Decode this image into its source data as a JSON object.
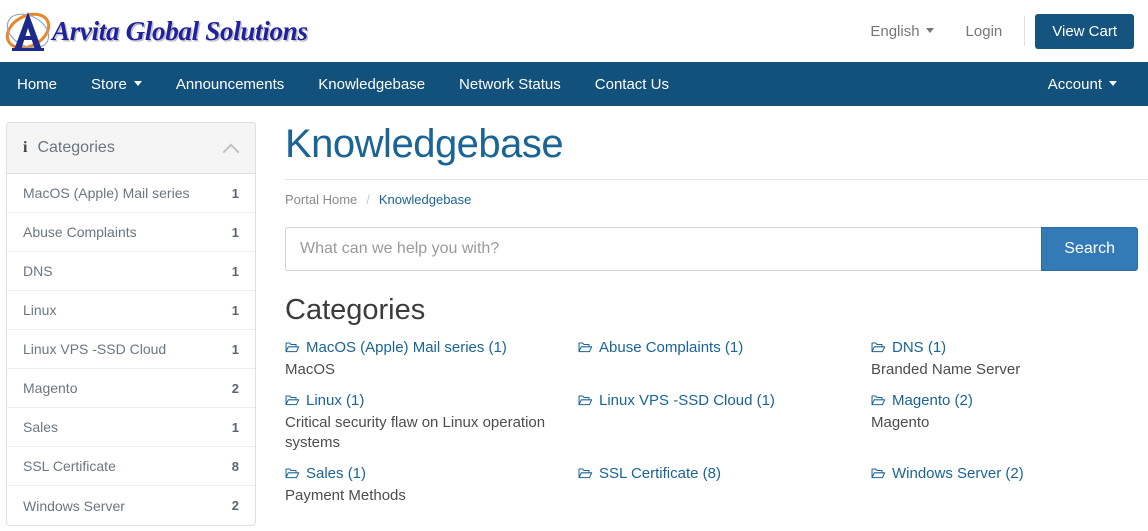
{
  "header": {
    "brand_name": "Arvita Global Solutions",
    "logo_icon": "arvita-a-logo",
    "language_label": "English",
    "login_label": "Login",
    "view_cart_label": "View Cart"
  },
  "nav": {
    "items": [
      {
        "label": "Home",
        "has_caret": false
      },
      {
        "label": "Store",
        "has_caret": true
      },
      {
        "label": "Announcements",
        "has_caret": false
      },
      {
        "label": "Knowledgebase",
        "has_caret": false
      },
      {
        "label": "Network Status",
        "has_caret": false
      },
      {
        "label": "Contact Us",
        "has_caret": false
      }
    ],
    "account_label": "Account"
  },
  "sidebar": {
    "panel_title": "Categories",
    "info_icon": "info-icon",
    "collapse_icon": "chevron-up-icon",
    "items": [
      {
        "label": "MacOS (Apple) Mail series",
        "count": "1"
      },
      {
        "label": "Abuse Complaints",
        "count": "1"
      },
      {
        "label": "DNS",
        "count": "1"
      },
      {
        "label": "Linux",
        "count": "1"
      },
      {
        "label": "Linux VPS -SSD Cloud",
        "count": "1"
      },
      {
        "label": "Magento",
        "count": "2"
      },
      {
        "label": "Sales",
        "count": "1"
      },
      {
        "label": "SSL Certificate",
        "count": "8"
      },
      {
        "label": "Windows Server",
        "count": "2"
      }
    ]
  },
  "main": {
    "page_title": "Knowledgebase",
    "breadcrumb": {
      "home_label": "Portal Home",
      "separator": "/",
      "current_label": "Knowledgebase"
    },
    "search": {
      "placeholder": "What can we help you with?",
      "value": "",
      "button_label": "Search"
    },
    "section_title": "Categories",
    "categories": [
      {
        "link": "MacOS (Apple) Mail series (1)",
        "desc": "MacOS",
        "icon": "folder-open-icon"
      },
      {
        "link": "Abuse Complaints (1)",
        "desc": "",
        "icon": "folder-open-icon"
      },
      {
        "link": "DNS (1)",
        "desc": "Branded Name Server",
        "icon": "folder-open-icon"
      },
      {
        "link": "Linux (1)",
        "desc": "Critical security flaw on Linux operation systems",
        "icon": "folder-open-icon"
      },
      {
        "link": "Linux VPS -SSD Cloud (1)",
        "desc": "",
        "icon": "folder-open-icon"
      },
      {
        "link": "Magento (2)",
        "desc": "Magento",
        "icon": "folder-open-icon"
      },
      {
        "link": "Sales (1)",
        "desc": "Payment Methods",
        "icon": "folder-open-icon"
      },
      {
        "link": "SSL Certificate (8)",
        "desc": "",
        "icon": "folder-open-icon"
      },
      {
        "link": "Windows Server (2)",
        "desc": "",
        "icon": "folder-open-icon"
      }
    ]
  },
  "colors": {
    "navbar_blue": "#11517c",
    "cart_blue": "#14547f",
    "search_blue": "#337ab7",
    "link_blue": "#1a6496",
    "brand_blue": "#21219c",
    "logo_orange": "#e8862a"
  }
}
